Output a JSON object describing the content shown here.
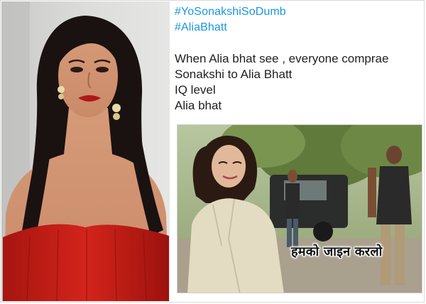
{
  "tweet": {
    "hashtags": [
      "#YoSonakshiSoDumb",
      "#AliaBhatt"
    ],
    "lines": [
      "When Alia bhat see , everyone comprae",
      "Sonakshi to Alia Bhatt",
      "IQ level",
      "Alia bhat"
    ]
  },
  "meme": {
    "caption": "हमको जाइन करलो"
  },
  "colors": {
    "hashtag": "#1b95e0",
    "text": "#1f1f1f",
    "dress": "#c9201a",
    "background": "#ffffff"
  }
}
